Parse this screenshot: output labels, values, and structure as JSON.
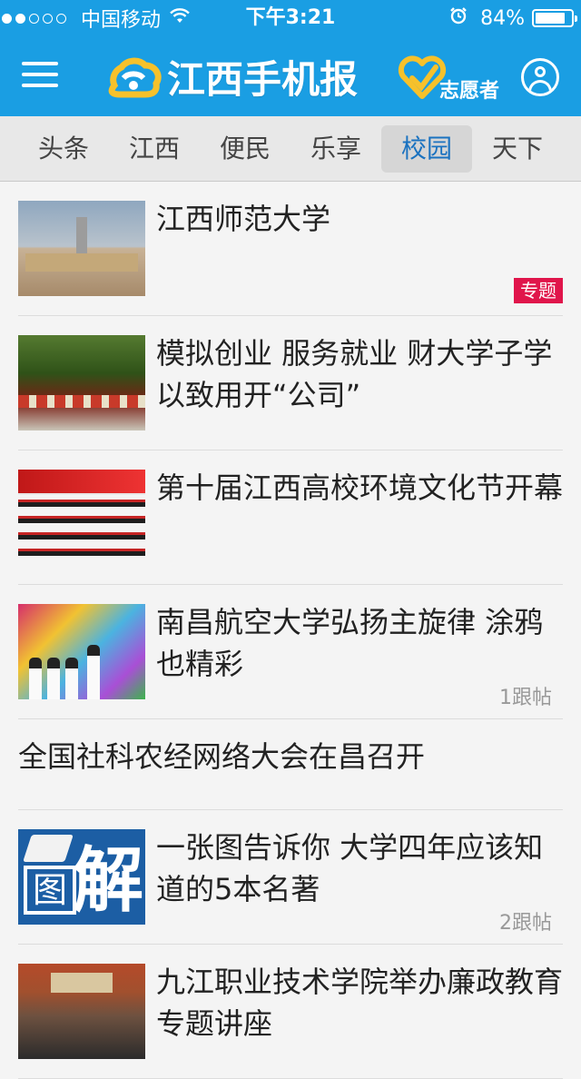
{
  "status_bar": {
    "carrier": "中国移动",
    "time": "下午3:21",
    "battery_text": "84%",
    "battery_level": 0.84,
    "signal_bars_filled": 2,
    "signal_bars_total": 5
  },
  "header": {
    "logo_text": "江西手机报",
    "volunteer_label": "志愿者",
    "brand_color": "#1a9ee3",
    "accent_color": "#f6c12b"
  },
  "tabs": [
    {
      "label": "头条"
    },
    {
      "label": "江西"
    },
    {
      "label": "便民"
    },
    {
      "label": "乐享"
    },
    {
      "label": "校园",
      "active": true
    },
    {
      "label": "天下"
    }
  ],
  "news": [
    {
      "title": "江西师范大学",
      "badge": "专题",
      "replies": ""
    },
    {
      "title": "模拟创业 服务就业 财大学子学以致用开“公司”",
      "badge": "",
      "replies": ""
    },
    {
      "title": "第十届江西高校环境文化节开幕",
      "badge": "",
      "replies": ""
    },
    {
      "title": "南昌航空大学弘扬主旋律 涂鸦也精彩",
      "badge": "",
      "replies": "1跟帖"
    },
    {
      "title": "全国社科农经网络大会在昌召开",
      "badge": "",
      "replies": ""
    },
    {
      "title": "一张图告诉你 大学四年应该知道的5本名著",
      "badge": "",
      "replies": "2跟帖",
      "thumb_text": [
        "图",
        "解"
      ]
    },
    {
      "title": "九江职业技术学院举办廉政教育专题讲座",
      "badge": "",
      "replies": ""
    }
  ],
  "badge_color": "#e0154b"
}
